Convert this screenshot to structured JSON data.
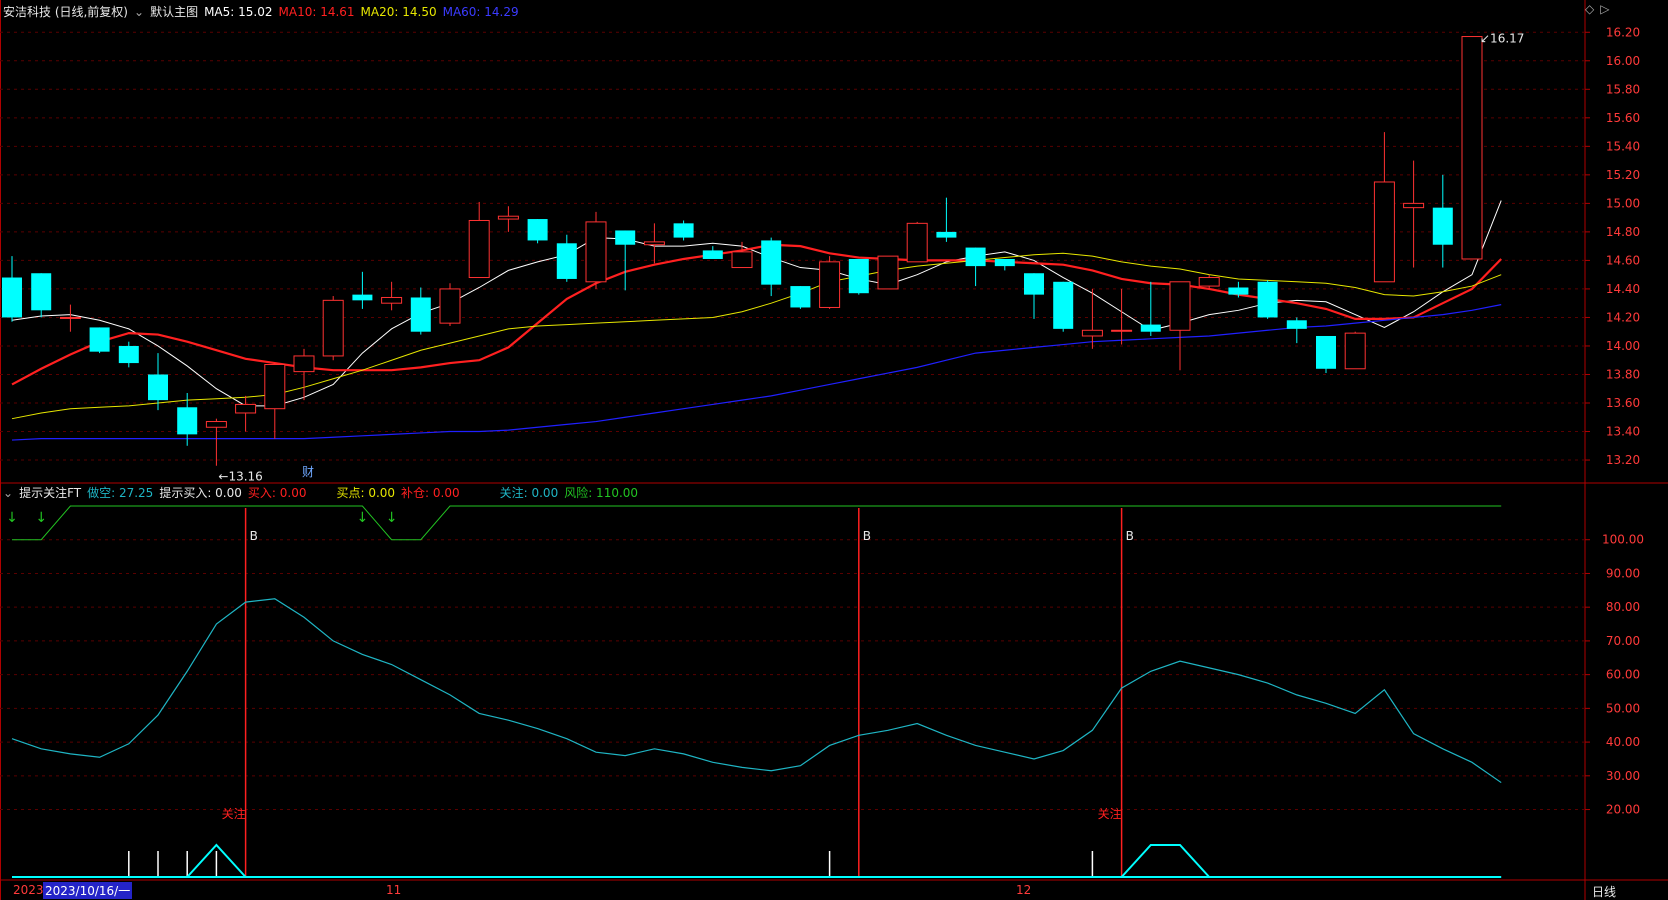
{
  "header": {
    "stock": "安洁科技 (日线,前复权)",
    "template": "默认主图",
    "ma5_label": "MA5: 15.02",
    "ma10_label": "MA10: 14.61",
    "ma20_label": "MA20: 14.50",
    "ma60_label": "MA60: 14.29"
  },
  "indicator_header": {
    "name": "提示关注FT",
    "item1": "做空: 27.25",
    "item2": "提示买入: 0.00",
    "item3": "买入: 0.00",
    "item4": "买点: 0.00",
    "item5": "补仓: 0.00",
    "item6": "关注: 0.00",
    "item7": "风险: 110.00"
  },
  "bottom": {
    "year": "2023",
    "date_cursor": "2023/10/16/一",
    "month1": "11",
    "month2": "12",
    "period": "日线"
  },
  "colors": {
    "up": "#ff3232",
    "down": "#00ffff",
    "ma5": "#ffffff",
    "ma10": "#ff2020",
    "ma20": "#e6e600",
    "ma60": "#2020ff",
    "grid": "#5a0000",
    "axis": "#b00000",
    "osc": "#1fb5c4",
    "green": "#22c322"
  },
  "chart_data": [
    {
      "type": "candlestick",
      "title": "安洁科技 (日线,前复权)",
      "y_ticks": [
        "13.20",
        "13.40",
        "13.60",
        "13.80",
        "14.00",
        "14.20",
        "14.40",
        "14.60",
        "14.80",
        "15.00",
        "15.20",
        "15.40",
        "15.60",
        "15.80",
        "16.00",
        "16.20"
      ],
      "ylim": [
        13.06,
        16.3
      ],
      "annotations": {
        "low": "←13.16",
        "high": "16.17",
        "fin_marker": "财"
      },
      "candles": [
        {
          "o": 14.48,
          "h": 14.63,
          "l": 14.17,
          "c": 14.2
        },
        {
          "o": 14.51,
          "h": 14.51,
          "l": 14.2,
          "c": 14.25
        },
        {
          "o": 14.2,
          "h": 14.29,
          "l": 14.1,
          "c": 14.2
        },
        {
          "o": 14.13,
          "h": 14.13,
          "l": 13.95,
          "c": 13.96
        },
        {
          "o": 14.0,
          "h": 14.03,
          "l": 13.85,
          "c": 13.88
        },
        {
          "o": 13.8,
          "h": 13.95,
          "l": 13.55,
          "c": 13.62
        },
        {
          "o": 13.57,
          "h": 13.67,
          "l": 13.3,
          "c": 13.38
        },
        {
          "o": 13.43,
          "h": 13.49,
          "l": 13.16,
          "c": 13.47
        },
        {
          "o": 13.53,
          "h": 13.65,
          "l": 13.4,
          "c": 13.59
        },
        {
          "o": 13.56,
          "h": 13.88,
          "l": 13.35,
          "c": 13.87
        },
        {
          "o": 13.82,
          "h": 13.98,
          "l": 13.62,
          "c": 13.93
        },
        {
          "o": 13.93,
          "h": 14.35,
          "l": 13.9,
          "c": 14.32
        },
        {
          "o": 14.36,
          "h": 14.52,
          "l": 14.26,
          "c": 14.32
        },
        {
          "o": 14.3,
          "h": 14.45,
          "l": 14.25,
          "c": 14.34
        },
        {
          "o": 14.34,
          "h": 14.41,
          "l": 14.08,
          "c": 14.1
        },
        {
          "o": 14.16,
          "h": 14.44,
          "l": 14.14,
          "c": 14.4
        },
        {
          "o": 14.48,
          "h": 15.01,
          "l": 14.48,
          "c": 14.88
        },
        {
          "o": 14.89,
          "h": 14.98,
          "l": 14.8,
          "c": 14.91
        },
        {
          "o": 14.89,
          "h": 14.89,
          "l": 14.72,
          "c": 14.74
        },
        {
          "o": 14.72,
          "h": 14.78,
          "l": 14.45,
          "c": 14.47
        },
        {
          "o": 14.45,
          "h": 14.94,
          "l": 14.4,
          "c": 14.87
        },
        {
          "o": 14.81,
          "h": 14.81,
          "l": 14.39,
          "c": 14.71
        },
        {
          "o": 14.71,
          "h": 14.86,
          "l": 14.58,
          "c": 14.73
        },
        {
          "o": 14.86,
          "h": 14.88,
          "l": 14.74,
          "c": 14.76
        },
        {
          "o": 14.67,
          "h": 14.7,
          "l": 14.62,
          "c": 14.61
        },
        {
          "o": 14.55,
          "h": 14.73,
          "l": 14.55,
          "c": 14.66
        },
        {
          "o": 14.74,
          "h": 14.76,
          "l": 14.35,
          "c": 14.43
        },
        {
          "o": 14.42,
          "h": 14.42,
          "l": 14.26,
          "c": 14.27
        },
        {
          "o": 14.27,
          "h": 14.63,
          "l": 14.26,
          "c": 14.59
        },
        {
          "o": 14.61,
          "h": 14.61,
          "l": 14.36,
          "c": 14.37
        },
        {
          "o": 14.4,
          "h": 14.63,
          "l": 14.4,
          "c": 14.63
        },
        {
          "o": 14.59,
          "h": 14.87,
          "l": 14.59,
          "c": 14.86
        },
        {
          "o": 14.8,
          "h": 15.04,
          "l": 14.73,
          "c": 14.76
        },
        {
          "o": 14.69,
          "h": 14.69,
          "l": 14.42,
          "c": 14.56
        },
        {
          "o": 14.61,
          "h": 14.61,
          "l": 14.53,
          "c": 14.56
        },
        {
          "o": 14.51,
          "h": 14.51,
          "l": 14.19,
          "c": 14.36
        },
        {
          "o": 14.45,
          "h": 14.45,
          "l": 14.1,
          "c": 14.12
        },
        {
          "o": 14.07,
          "h": 14.4,
          "l": 13.98,
          "c": 14.11
        },
        {
          "o": 14.11,
          "h": 14.4,
          "l": 14.01,
          "c": 14.11
        },
        {
          "o": 14.15,
          "h": 14.45,
          "l": 14.07,
          "c": 14.1
        },
        {
          "o": 14.11,
          "h": 14.45,
          "l": 13.83,
          "c": 14.45
        },
        {
          "o": 14.42,
          "h": 14.5,
          "l": 14.4,
          "c": 14.48
        },
        {
          "o": 14.41,
          "h": 14.45,
          "l": 14.34,
          "c": 14.36
        },
        {
          "o": 14.45,
          "h": 14.46,
          "l": 14.19,
          "c": 14.2
        },
        {
          "o": 14.18,
          "h": 14.2,
          "l": 14.02,
          "c": 14.12
        },
        {
          "o": 14.07,
          "h": 14.07,
          "l": 13.81,
          "c": 13.84
        },
        {
          "o": 13.84,
          "h": 14.1,
          "l": 13.84,
          "c": 14.09
        },
        {
          "o": 14.45,
          "h": 15.5,
          "l": 14.45,
          "c": 15.15
        },
        {
          "o": 14.97,
          "h": 15.3,
          "l": 14.55,
          "c": 15.0
        },
        {
          "o": 14.97,
          "h": 15.2,
          "l": 14.55,
          "c": 14.71
        },
        {
          "o": 14.61,
          "h": 16.17,
          "l": 14.61,
          "c": 16.17
        }
      ],
      "ma": {
        "MA5": [
          14.18,
          14.21,
          14.22,
          14.18,
          14.12,
          14.0,
          13.86,
          13.7,
          13.58,
          13.58,
          13.64,
          13.73,
          13.95,
          14.12,
          14.23,
          14.3,
          14.41,
          14.53,
          14.59,
          14.64,
          14.76,
          14.75,
          14.7,
          14.7,
          14.72,
          14.7,
          14.62,
          14.55,
          14.53,
          14.47,
          14.43,
          14.5,
          14.59,
          14.63,
          14.66,
          14.6,
          14.48,
          14.37,
          14.24,
          14.11,
          14.16,
          14.22,
          14.25,
          14.3,
          14.32,
          14.31,
          14.22,
          14.13,
          14.24,
          14.38,
          14.5,
          15.02
        ],
        "MA10": [
          13.73,
          13.84,
          13.94,
          14.03,
          14.09,
          14.08,
          14.03,
          13.97,
          13.91,
          13.88,
          13.85,
          13.83,
          13.83,
          13.83,
          13.85,
          13.88,
          13.9,
          13.99,
          14.16,
          14.33,
          14.44,
          14.52,
          14.57,
          14.61,
          14.64,
          14.67,
          14.71,
          14.7,
          14.65,
          14.62,
          14.61,
          14.6,
          14.6,
          14.6,
          14.59,
          14.58,
          14.57,
          14.53,
          14.47,
          14.44,
          14.43,
          14.4,
          14.36,
          14.33,
          14.3,
          14.26,
          14.19,
          14.19,
          14.2,
          14.3,
          14.4,
          14.61
        ],
        "MA20": [
          13.49,
          13.53,
          13.56,
          13.57,
          13.58,
          13.6,
          13.62,
          13.63,
          13.64,
          13.66,
          13.71,
          13.77,
          13.83,
          13.9,
          13.97,
          14.02,
          14.07,
          14.12,
          14.14,
          14.15,
          14.16,
          14.17,
          14.18,
          14.19,
          14.2,
          14.24,
          14.3,
          14.37,
          14.45,
          14.49,
          14.53,
          14.56,
          14.58,
          14.6,
          14.62,
          14.64,
          14.65,
          14.63,
          14.59,
          14.56,
          14.54,
          14.5,
          14.47,
          14.46,
          14.45,
          14.44,
          14.41,
          14.36,
          14.35,
          14.38,
          14.42,
          14.5
        ],
        "MA60": [
          13.34,
          13.35,
          13.35,
          13.35,
          13.35,
          13.35,
          13.35,
          13.35,
          13.35,
          13.35,
          13.35,
          13.36,
          13.37,
          13.38,
          13.39,
          13.4,
          13.4,
          13.41,
          13.43,
          13.45,
          13.47,
          13.5,
          13.53,
          13.56,
          13.59,
          13.62,
          13.65,
          13.69,
          13.73,
          13.77,
          13.81,
          13.85,
          13.9,
          13.95,
          13.97,
          13.99,
          14.01,
          14.03,
          14.04,
          14.05,
          14.06,
          14.07,
          14.09,
          14.11,
          14.13,
          14.14,
          14.16,
          14.18,
          14.2,
          14.22,
          14.25,
          14.29
        ]
      }
    },
    {
      "type": "line",
      "title": "提示关注FT",
      "y_ticks": [
        "20.00",
        "30.00",
        "40.00",
        "50.00",
        "60.00",
        "70.00",
        "80.00",
        "90.00",
        "100.00"
      ],
      "ylim": [
        0,
        110
      ],
      "series": [
        {
          "name": "做空",
          "values": [
            41,
            38,
            36.5,
            35.5,
            39.5,
            48,
            61,
            75,
            81.5,
            82.5,
            77,
            70,
            66,
            63,
            58.5,
            54,
            48.5,
            46.5,
            44,
            41,
            37,
            36,
            38,
            36.5,
            34,
            32.5,
            31.5,
            33,
            39,
            42,
            43.5,
            45.5,
            42,
            39,
            37,
            35,
            37.5,
            43.5,
            56,
            61,
            64,
            62,
            60,
            57.5,
            54,
            51.5,
            48.5,
            55.5,
            42.5,
            38,
            34,
            28
          ]
        },
        {
          "name": "风险",
          "values": [
            100,
            100,
            110,
            110,
            110,
            110,
            110,
            110,
            110,
            110,
            110,
            110,
            110,
            100,
            100,
            110,
            110,
            110,
            110,
            110,
            110,
            110,
            110,
            110,
            110,
            110,
            110,
            110,
            110,
            110,
            110,
            110,
            110,
            110,
            110,
            110,
            110,
            110,
            110,
            110,
            110,
            110,
            110,
            110,
            110,
            110,
            110,
            110,
            110,
            110,
            110,
            110
          ]
        }
      ],
      "markers": {
        "B_label": "B",
        "B_at": [
          8,
          29,
          38
        ],
        "focus_label": "关注",
        "focus_at": [
          8,
          38
        ],
        "down_arrow_at": [
          0,
          1,
          12,
          13
        ],
        "white_ticks_at": [
          4,
          5,
          6,
          7,
          28,
          37
        ],
        "signal_bumps": [
          [
            6,
            7,
            8
          ],
          [
            38,
            39,
            40,
            41
          ]
        ]
      }
    }
  ]
}
